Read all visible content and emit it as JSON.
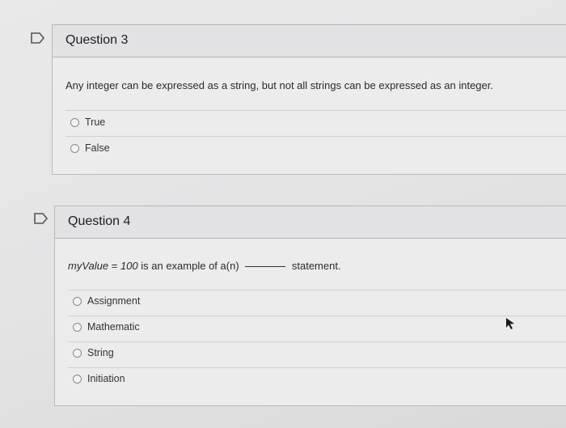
{
  "questions": [
    {
      "title": "Question 3",
      "prompt": "Any integer can be expressed as a string, but not all strings can be expressed as an integer.",
      "options": [
        "True",
        "False"
      ]
    },
    {
      "title": "Question 4",
      "prompt_var": "myValue",
      "prompt_eq": " = ",
      "prompt_num": "100",
      "prompt_mid": " is an example of a(n) ",
      "prompt_end": " statement.",
      "options": [
        "Assignment",
        "Mathematic",
        "String",
        "Initiation"
      ]
    }
  ]
}
